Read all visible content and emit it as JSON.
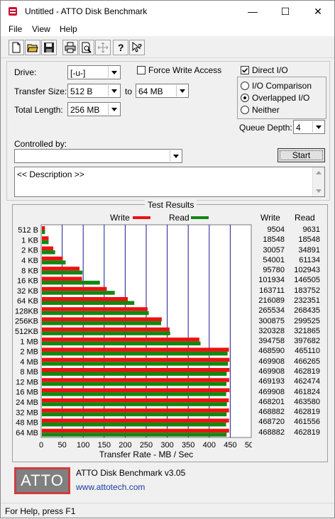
{
  "window": {
    "title": "Untitled - ATTO Disk Benchmark",
    "controls": {
      "minimize": "—",
      "maximize": "☐",
      "close": "✕"
    }
  },
  "menu": [
    "File",
    "View",
    "Help"
  ],
  "toolbar": [
    "new-icon",
    "open-icon",
    "save-icon",
    "print-icon",
    "print-preview-icon",
    "move-icon",
    "about-icon",
    "context-help-icon"
  ],
  "settings": {
    "drive_label": "Drive:",
    "drive_value": "[-u-]",
    "transfer_size_label": "Transfer Size:",
    "transfer_from": "512 B",
    "transfer_to_label": "to",
    "transfer_to": "64 MB",
    "total_length_label": "Total Length:",
    "total_length": "256 MB",
    "force_write_label": "Force Write Access",
    "force_write_checked": false,
    "direct_io_label": "Direct I/O",
    "direct_io_checked": true,
    "io_comparison_label": "I/O Comparison",
    "overlapped_io_label": "Overlapped I/O",
    "neither_label": "Neither",
    "selected_io_mode": "Overlapped I/O",
    "queue_depth_label": "Queue Depth:",
    "queue_depth": "4",
    "controlled_by_label": "Controlled by:",
    "controlled_by_value": "",
    "start_label": "Start",
    "description": "<< Description >>"
  },
  "results": {
    "group_title": "Test Results",
    "legend_write": "Write",
    "legend_read": "Read",
    "col_write": "Write",
    "col_read": "Read",
    "write_color": "#ee1111",
    "read_color": "#118811",
    "rows": [
      {
        "size": "512 B",
        "write": "9504",
        "read": "9631"
      },
      {
        "size": "1 KB",
        "write": "18548",
        "read": "18548"
      },
      {
        "size": "2 KB",
        "write": "30057",
        "read": "34891"
      },
      {
        "size": "4 KB",
        "write": "54001",
        "read": "61134"
      },
      {
        "size": "8 KB",
        "write": "95780",
        "read": "102943"
      },
      {
        "size": "16 KB",
        "write": "101934",
        "read": "146505"
      },
      {
        "size": "32 KB",
        "write": "163711",
        "read": "183752"
      },
      {
        "size": "64 KB",
        "write": "216089",
        "read": "232351"
      },
      {
        "size": "128KB",
        "write": "265534",
        "read": "268435"
      },
      {
        "size": "256KB",
        "write": "300875",
        "read": "299525"
      },
      {
        "size": "512KB",
        "write": "320328",
        "read": "321865"
      },
      {
        "size": "1 MB",
        "write": "394758",
        "read": "397682"
      },
      {
        "size": "2 MB",
        "write": "468590",
        "read": "465110"
      },
      {
        "size": "4 MB",
        "write": "469908",
        "read": "466265"
      },
      {
        "size": "8 MB",
        "write": "469908",
        "read": "462819"
      },
      {
        "size": "12 MB",
        "write": "469193",
        "read": "462474"
      },
      {
        "size": "16 MB",
        "write": "469908",
        "read": "461824"
      },
      {
        "size": "24 MB",
        "write": "468201",
        "read": "463580"
      },
      {
        "size": "32 MB",
        "write": "468882",
        "read": "462819"
      },
      {
        "size": "48 MB",
        "write": "468720",
        "read": "461556"
      },
      {
        "size": "64 MB",
        "write": "468882",
        "read": "462819"
      }
    ]
  },
  "chart_data": {
    "type": "bar",
    "orientation": "horizontal",
    "categories": [
      "512 B",
      "1 KB",
      "2 KB",
      "4 KB",
      "8 KB",
      "16 KB",
      "32 KB",
      "64 KB",
      "128KB",
      "256KB",
      "512KB",
      "1 MB",
      "2 MB",
      "4 MB",
      "8 MB",
      "12 MB",
      "16 MB",
      "24 MB",
      "32 MB",
      "48 MB",
      "64 MB"
    ],
    "series": [
      {
        "name": "Write",
        "values": [
          9.1,
          17.7,
          28.7,
          51.5,
          91.3,
          97.2,
          156.1,
          206.1,
          253.2,
          286.9,
          305.5,
          376.5,
          446.9,
          448.1,
          448.1,
          447.5,
          448.1,
          446.5,
          447.2,
          447.0,
          447.2
        ]
      },
      {
        "name": "Read",
        "values": [
          9.2,
          17.7,
          33.3,
          58.3,
          98.2,
          139.7,
          175.2,
          221.6,
          256.0,
          285.6,
          307.0,
          379.3,
          443.6,
          444.7,
          441.4,
          441.0,
          440.4,
          442.1,
          441.4,
          440.2,
          441.4
        ]
      }
    ],
    "xlabel": "Transfer Rate - MB / Sec",
    "xlim": [
      0,
      500
    ],
    "xticks": [
      "0",
      "50",
      "100",
      "150",
      "200",
      "250",
      "300",
      "350",
      "400",
      "450",
      "500"
    ],
    "grid": true,
    "legend": "top"
  },
  "footer": {
    "logo_text": "ATTO",
    "product": "ATTO Disk Benchmark v3.05",
    "url": "www.attotech.com"
  },
  "status": "For Help, press F1"
}
